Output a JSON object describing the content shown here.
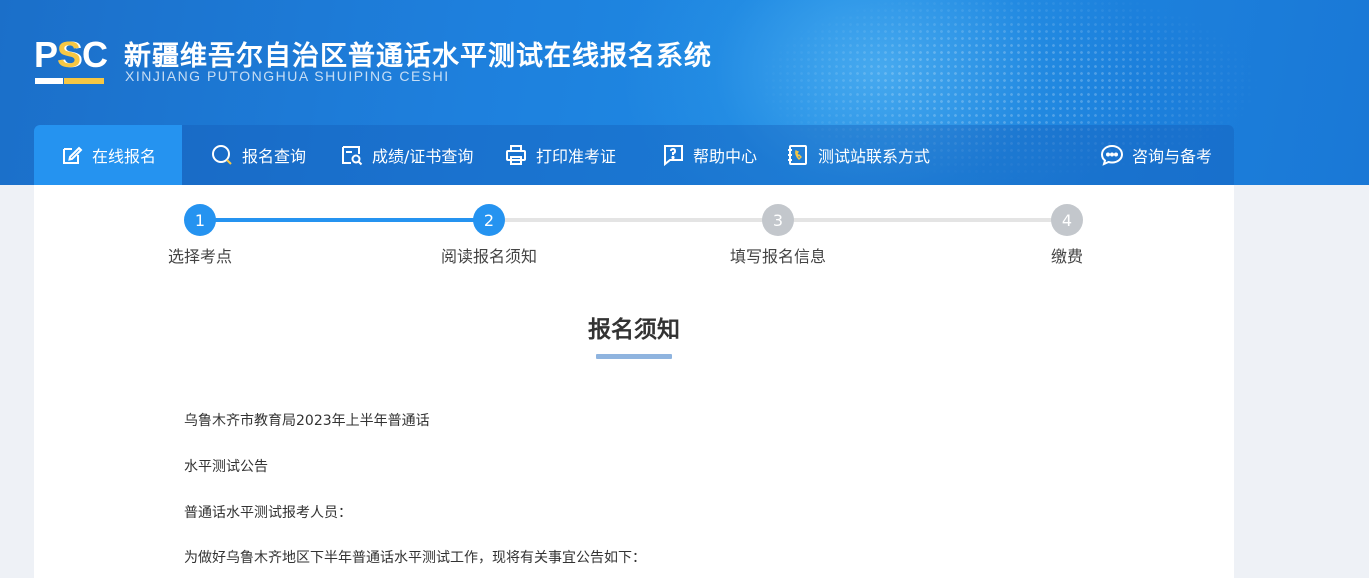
{
  "header": {
    "logo_ps": "PS",
    "logo_s": "",
    "logo_c": "C",
    "title": "新疆维吾尔自治区普通话水平测试在线报名系统",
    "subtitle": "XINJIANG PUTONGHUA SHUIPING CESHI"
  },
  "nav": {
    "items": [
      {
        "label": "在线报名",
        "icon": "edit-icon"
      },
      {
        "label": "报名查询",
        "icon": "search-icon"
      },
      {
        "label": "成绩/证书查询",
        "icon": "certificate-search-icon"
      },
      {
        "label": "打印准考证",
        "icon": "printer-icon"
      },
      {
        "label": "帮助中心",
        "icon": "help-icon"
      },
      {
        "label": "测试站联系方式",
        "icon": "phone-book-icon"
      },
      {
        "label": "咨询与备考",
        "icon": "chat-icon"
      }
    ]
  },
  "steps": [
    {
      "num": "1",
      "label": "选择考点"
    },
    {
      "num": "2",
      "label": "阅读报名须知"
    },
    {
      "num": "3",
      "label": "填写报名信息"
    },
    {
      "num": "4",
      "label": "缴费"
    }
  ],
  "notice": {
    "title": "报名须知",
    "paragraphs": [
      "乌鲁木齐市教育局2023年上半年普通话",
      "水平测试公告",
      "普通话水平测试报考人员：",
      "为做好乌鲁木齐地区下半年普通话水平测试工作，现将有关事宜公告如下："
    ]
  },
  "colors": {
    "primary": "#2593f0",
    "header": "#1e80dd",
    "inactive_step": "#c3c7cc",
    "logo_accent": "#f6c744"
  }
}
